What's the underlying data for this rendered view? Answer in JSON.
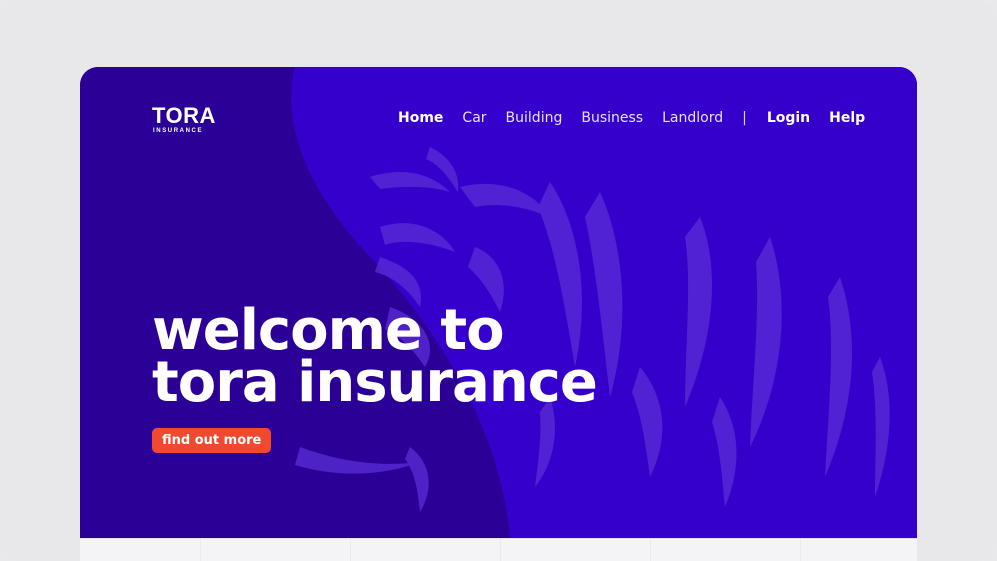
{
  "brand": {
    "name": "TORA",
    "tagline": "INSURANCE"
  },
  "nav": {
    "items": [
      {
        "label": "Home",
        "bold": true
      },
      {
        "label": "Car",
        "bold": false
      },
      {
        "label": "Building",
        "bold": false
      },
      {
        "label": "Business",
        "bold": false
      },
      {
        "label": "Landlord",
        "bold": false
      }
    ],
    "separator": "|",
    "login_label": "Login",
    "help_label": "Help"
  },
  "hero": {
    "headline_line1": "welcome to",
    "headline_line2": "tora insurance",
    "cta_label": "find out more",
    "background_graphic": "tiger-icon"
  },
  "colors": {
    "hero_dark": "#2b0096",
    "hero_light": "#3a00cc",
    "accent": "#f0492f",
    "text": "#ffffff",
    "frame": "#e8e8eb"
  }
}
